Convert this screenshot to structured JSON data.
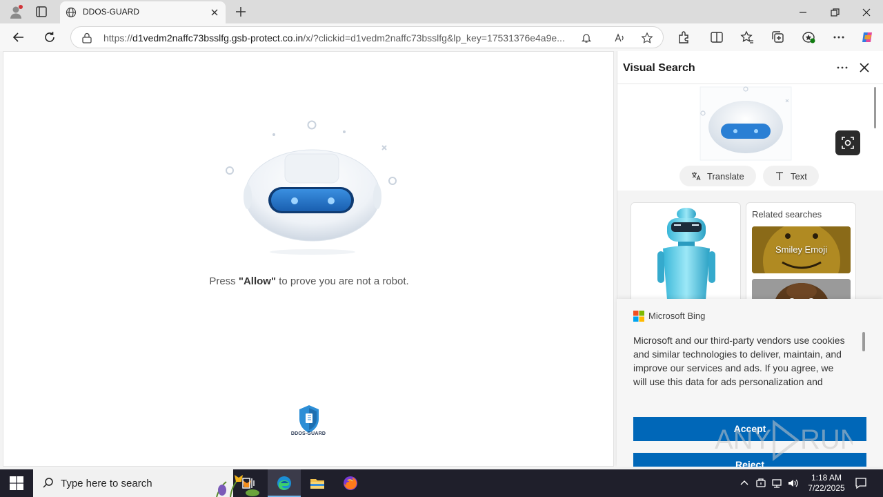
{
  "browser": {
    "tab_title": "DDOS-GUARD",
    "url_prefix": "https://",
    "url_host": "d1vedm2naffc73bsslfg.gsb-protect.co.in",
    "url_rest": "/x/?clickid=d1vedm2naffc73bsslfg&lp_key=17531376e4a9e..."
  },
  "page": {
    "prompt_before": "Press ",
    "prompt_allow": "\"Allow\"",
    "prompt_after": " to prove you are not a robot.",
    "brand": "DDOS-GUARD"
  },
  "visual_search": {
    "title": "Visual Search",
    "chips": [
      "Translate",
      "Text"
    ],
    "related_title": "Related searches",
    "related_items": [
      "Smiley Emoji",
      ""
    ]
  },
  "cookie": {
    "brand": "Microsoft Bing",
    "text": "Microsoft and our third-party vendors use cookies and similar technologies to deliver, maintain, and improve our services and ads. If you agree, we will use this data for ads personalization and",
    "accept": "Accept",
    "reject": "Reject"
  },
  "watermark": "ANY RUN",
  "taskbar": {
    "search_placeholder": "Type here to search",
    "time": "1:18 AM",
    "date": "7/22/2025"
  },
  "colors": {
    "accent": "#0067b8",
    "robot_eye": "#2a7fd4",
    "taskbar": "#1f1f2b"
  }
}
